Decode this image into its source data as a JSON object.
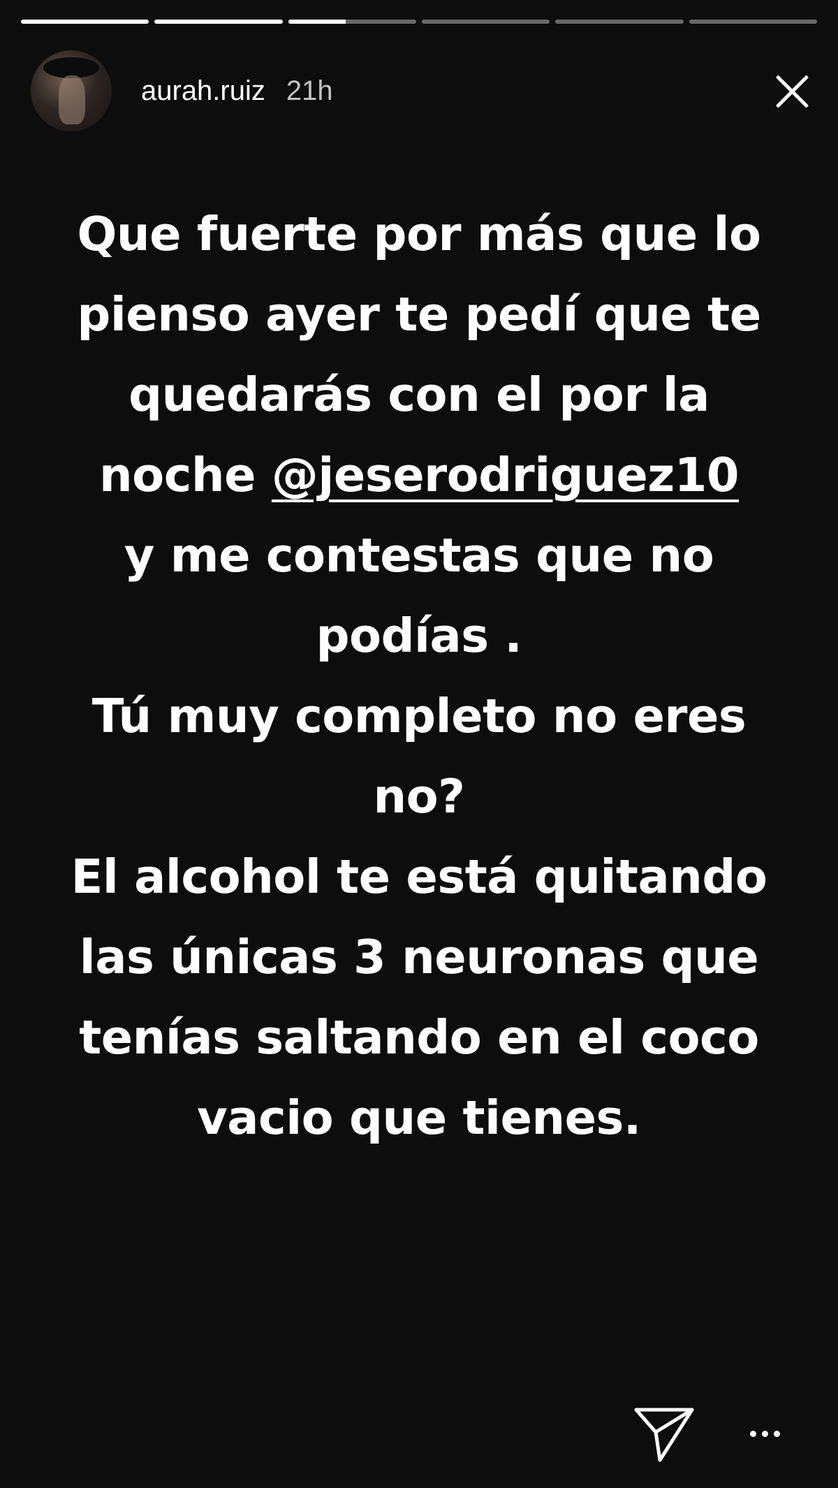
{
  "progress": {
    "segments": [
      {
        "fill": 1.0
      },
      {
        "fill": 1.0
      },
      {
        "fill": 0.45
      },
      {
        "fill": 0
      },
      {
        "fill": 0
      },
      {
        "fill": 0
      }
    ]
  },
  "header": {
    "username": "aurah.ruiz",
    "time": "21h",
    "avatar_icon": "profile-photo",
    "close_icon": "close-icon"
  },
  "caption": {
    "lines": [
      "Que fuerte por más que lo",
      "pienso ayer te pedí que te",
      "quedarás con el por la",
      "noche",
      "y me contestas que no",
      "podías .",
      "Tú muy completo no eres",
      "no?",
      "El alcohol te está quitando",
      "las únicas 3 neuronas que",
      "tenías saltando en el coco",
      "vacio que tienes."
    ],
    "mention": "@jeserodriguez10"
  },
  "footer": {
    "send_icon": "send-icon",
    "more_icon": "more-icon"
  },
  "colors": {
    "background": "#0d0d0d",
    "text": "#ffffff"
  }
}
